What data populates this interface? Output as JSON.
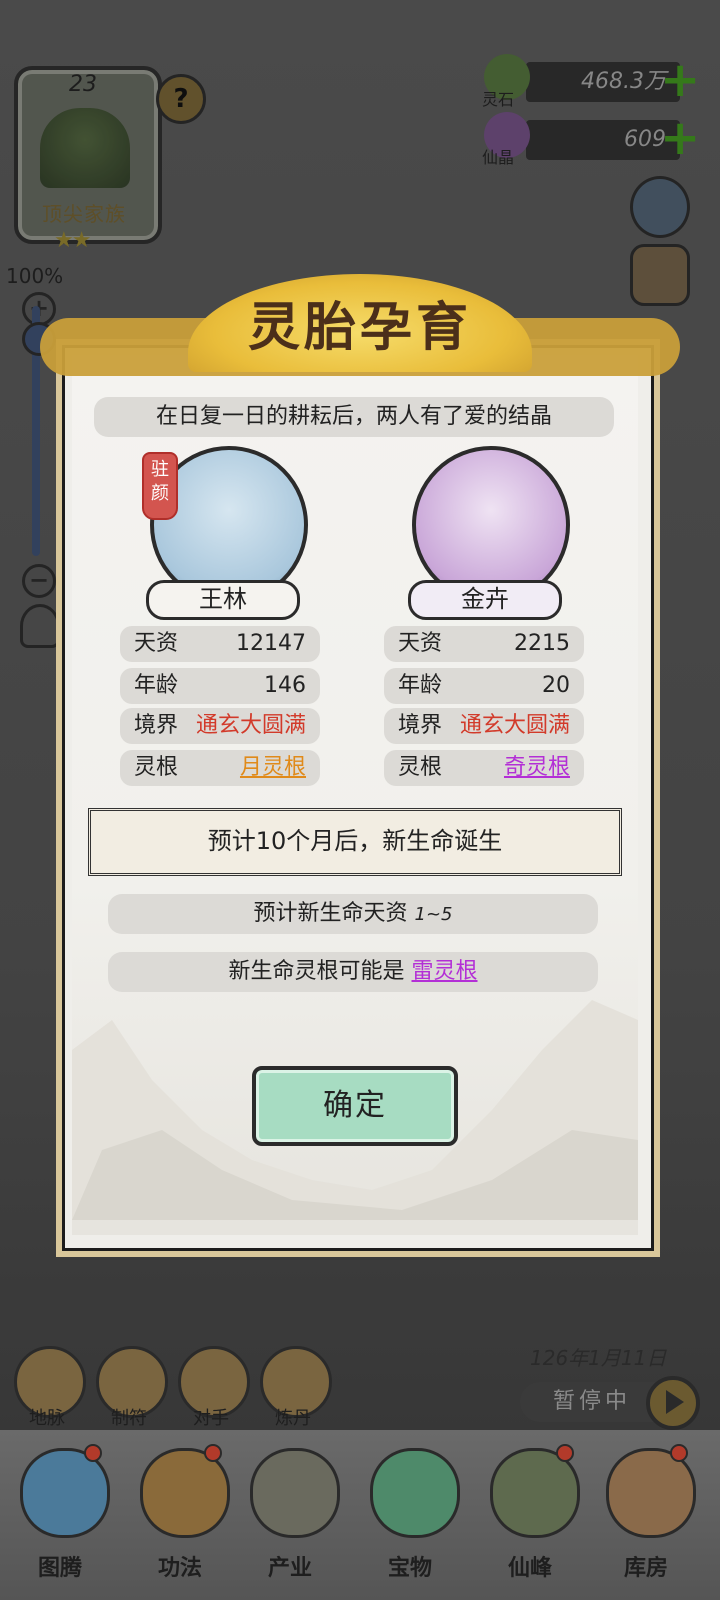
{
  "family": {
    "level": "23",
    "name": "顶尖家族",
    "stars": "★★",
    "help": "?"
  },
  "currency": {
    "spirit_stone_label": "灵石",
    "spirit_stone_value": "468.3万",
    "immortal_crystal_label": "仙晶",
    "immortal_crystal_value": "609",
    "plus": "+"
  },
  "zoom": {
    "percent": "100%",
    "plus": "+",
    "minus": "−",
    "level": 1.0
  },
  "modal": {
    "title": "灵胎孕育",
    "subtitle": "在日复一日的耕耘后，两人有了爱的结晶",
    "father": {
      "badge": "驻颜",
      "name": "王林",
      "talent_label": "天资",
      "talent": "12147",
      "age_label": "年龄",
      "age": "146",
      "realm_label": "境界",
      "realm": "通玄大圆满",
      "root_label": "灵根",
      "root": "月灵根"
    },
    "mother": {
      "name": "金卉",
      "talent_label": "天资",
      "talent": "2215",
      "age_label": "年龄",
      "age": "20",
      "realm_label": "境界",
      "realm": "通玄大圆满",
      "root_label": "灵根",
      "root": "奇灵根"
    },
    "notice": "预计10个月后，新生命诞生",
    "talent_forecast_label": "预计新生命天资",
    "talent_forecast_value": "1~5",
    "root_forecast_label": "新生命灵根可能是",
    "root_forecast_value": "雷灵根",
    "confirm": "确定"
  },
  "bottom": {
    "date": "126年1月11日",
    "pause": "暂停中",
    "small_buttons": [
      "地脉",
      "制符",
      "对手",
      "炼丹"
    ],
    "nav": [
      "图腾",
      "功法",
      "产业",
      "宝物",
      "仙峰",
      "库房"
    ]
  },
  "colors": {
    "accent_gold": "#e9bd3a",
    "confirm_green": "#a7dcc2",
    "realm_red": "#d23a2a",
    "root_orange": "#e08a1a",
    "root_purple": "#b32fd6"
  }
}
